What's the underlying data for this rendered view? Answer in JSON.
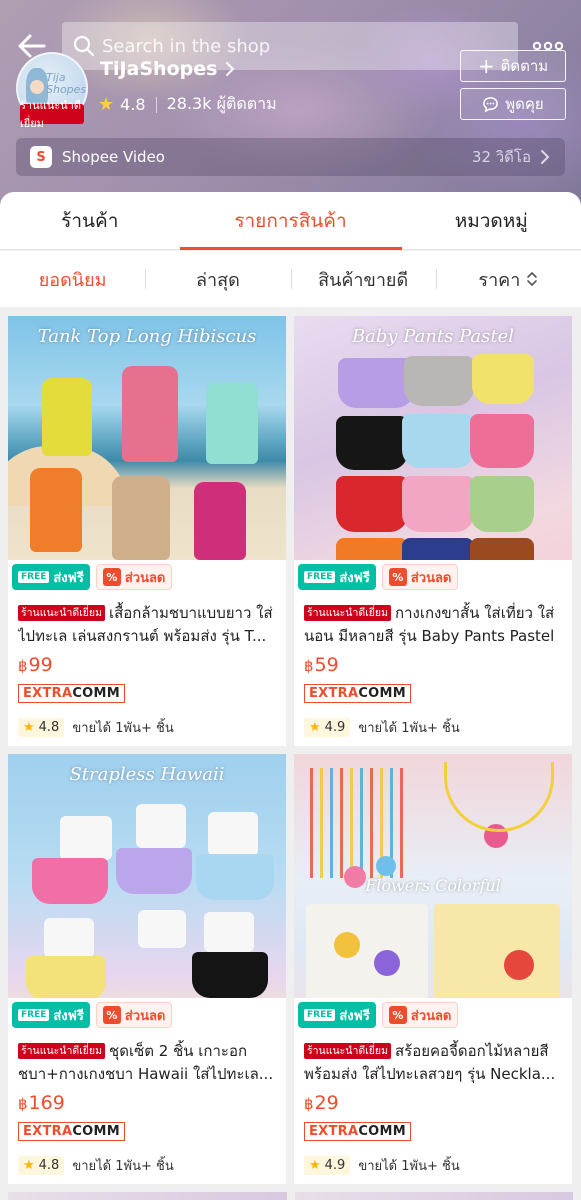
{
  "header": {
    "search_placeholder": "Search in the shop",
    "shop_name": "TiJaShopes",
    "avatar_text": "Tija\nShopes",
    "recommended_tag": "ร้านแนะนำดีเยี่ยม",
    "rating": "4.8",
    "followers": "28.3k ผู้ติดตาม",
    "follow_label": "ติดตาม",
    "chat_label": "พูดคุย",
    "video_label": "Shopee Video",
    "video_count": "32 วิดีโอ",
    "video_icon": "S"
  },
  "tabs": [
    {
      "label": "ร้านค้า",
      "active": false
    },
    {
      "label": "รายการสินค้า",
      "active": true
    },
    {
      "label": "หมวดหมู่",
      "active": false
    }
  ],
  "sort": [
    {
      "label": "ยอดนิยม",
      "active": true
    },
    {
      "label": "ล่าสุด",
      "active": false
    },
    {
      "label": "สินค้าขายดี",
      "active": false
    },
    {
      "label": "ราคา",
      "active": false
    }
  ],
  "promo": {
    "free_label": "ส่งฟรี",
    "free_badge": "FREE",
    "discount_label": "ส่วนลด",
    "pct": "%"
  },
  "extra_comm": {
    "extra": "EXTRA",
    "comm": "COMM"
  },
  "products": [
    {
      "image_title": "Tank Top Long Hibiscus",
      "tag": "ร้านแนะนำดีเยี่ยม",
      "title": "เสื้อกล้ามชบาแบบยาว ใส่ไปทะเล  เล่นสงกรานต์ พร้อมส่ง รุ่น T...",
      "currency": "฿",
      "price": "99",
      "rating": "4.8",
      "sold": "ขายได้ 1พัน+ ชิ้น"
    },
    {
      "image_title": "Baby Pants Pastel",
      "tag": "ร้านแนะนำดีเยี่ยม",
      "title": "กางเกงขาสั้น ใส่เที่ยว ใส่นอน มีหลายสี รุ่น Baby Pants Pastel",
      "currency": "฿",
      "price": "59",
      "rating": "4.9",
      "sold": "ขายได้ 1พัน+ ชิ้น"
    },
    {
      "image_title": "Strapless Hawaii",
      "tag": "ร้านแนะนำดีเยี่ยม",
      "title": "ชุดเซ็ต 2 ชิ้น เกาะอกชบา+กางเกงชบา Hawaii  ใส่ไปทะเล...",
      "currency": "฿",
      "price": "169",
      "rating": "4.8",
      "sold": "ขายได้ 1พัน+ ชิ้น"
    },
    {
      "image_title": "Flowers Colorful",
      "tag": "ร้านแนะนำดีเยี่ยม",
      "title": "สร้อยคอจี้ดอกไม้หลายสี พร้อมส่ง ใส่ไปทะเลสวยๆ รุ่น Neckla...",
      "currency": "฿",
      "price": "29",
      "rating": "4.9",
      "sold": "ขายได้ 1พัน+ ชิ้น"
    }
  ],
  "colors": {
    "accent": "#ee4d2d",
    "tag_red": "#d0011b",
    "free_green": "#00bfa5",
    "star": "#ffb400"
  }
}
